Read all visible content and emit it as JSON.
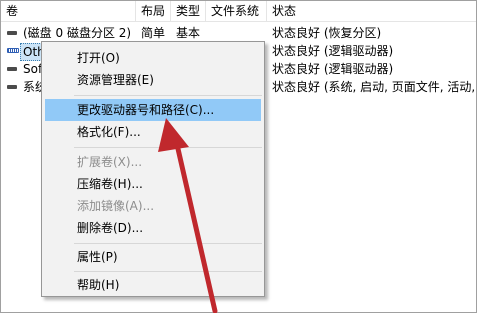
{
  "columns": [
    "卷",
    "布局",
    "类型",
    "文件系统",
    "状态"
  ],
  "rows": [
    {
      "volume": "(磁盘 0 磁盘分区 2)",
      "layout": "简单",
      "type": "基本",
      "fs": "",
      "status": "状态良好 (恢复分区)",
      "icon": "volume-icon"
    },
    {
      "volume": "Oth",
      "layout": "",
      "type": "",
      "fs": "",
      "status": "状态良好 (逻辑驱动器)",
      "icon": "volume-hatched-icon"
    },
    {
      "volume": "Sof",
      "layout": "",
      "type": "",
      "fs": "",
      "status": "状态良好 (逻辑驱动器)",
      "icon": "volume-icon"
    },
    {
      "volume": "系统",
      "layout": "",
      "type": "",
      "fs": "",
      "status": "状态良好 (系统, 启动, 页面文件, 活动, 故",
      "icon": "volume-icon"
    }
  ],
  "menu": {
    "items": [
      {
        "label": "打开(O)",
        "enabled": true
      },
      {
        "label": "资源管理器(E)",
        "enabled": true
      },
      {
        "label": "更改驱动器号和路径(C)...",
        "enabled": true,
        "highlighted": true
      },
      {
        "label": "格式化(F)...",
        "enabled": true
      },
      {
        "label": "扩展卷(X)...",
        "enabled": false
      },
      {
        "label": "压缩卷(H)...",
        "enabled": true
      },
      {
        "label": "添加镜像(A)...",
        "enabled": false
      },
      {
        "label": "删除卷(D)...",
        "enabled": true
      },
      {
        "label": "属性(P)",
        "enabled": true
      },
      {
        "label": "帮助(H)",
        "enabled": true
      }
    ]
  },
  "colors": {
    "menu_highlight": "#91c9f7",
    "selection": "#cce4f7",
    "arrow": "#c0282d"
  }
}
